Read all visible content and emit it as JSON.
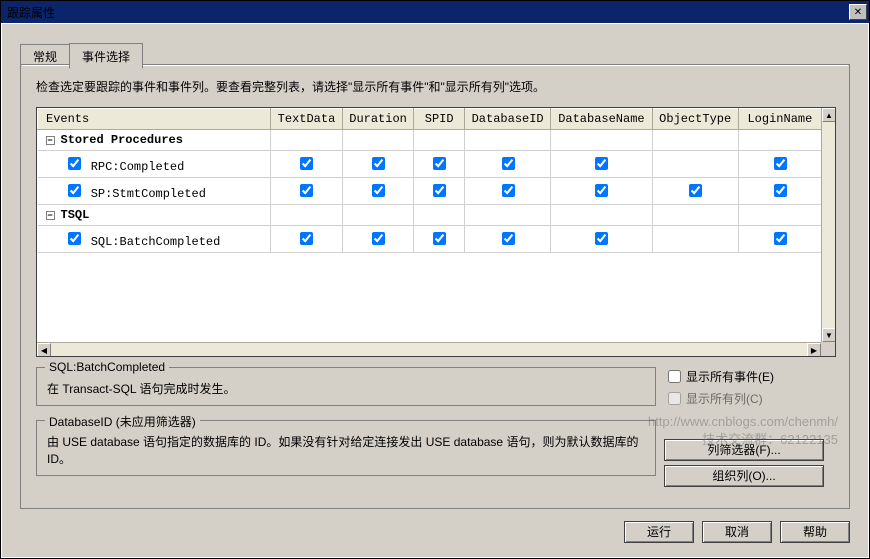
{
  "window": {
    "title": "跟踪属性"
  },
  "tabs": {
    "general": "常规",
    "events": "事件选择"
  },
  "instruction": "检查选定要跟踪的事件和事件列。要查看完整列表，请选择\"显示所有事件\"和\"显示所有列\"选项。",
  "columns": [
    "Events",
    "TextData",
    "Duration",
    "SPID",
    "DatabaseID",
    "DatabaseName",
    "ObjectType",
    "LoginName"
  ],
  "groups": [
    {
      "label": "Stored Procedures",
      "expanded": true,
      "events": [
        {
          "name": "RPC:Completed",
          "checked": true,
          "cols": {
            "TextData": true,
            "Duration": true,
            "SPID": true,
            "DatabaseID": true,
            "DatabaseName": true,
            "ObjectType": false,
            "LoginName": true
          }
        },
        {
          "name": "SP:StmtCompleted",
          "checked": true,
          "cols": {
            "TextData": true,
            "Duration": true,
            "SPID": true,
            "DatabaseID": true,
            "DatabaseName": true,
            "ObjectType": true,
            "LoginName": true
          }
        }
      ]
    },
    {
      "label": "TSQL",
      "expanded": true,
      "events": [
        {
          "name": "SQL:BatchCompleted",
          "checked": true,
          "cols": {
            "TextData": true,
            "Duration": true,
            "SPID": true,
            "DatabaseID": true,
            "DatabaseName": true,
            "ObjectType": false,
            "LoginName": true
          }
        }
      ]
    }
  ],
  "desc1": {
    "title": "SQL:BatchCompleted",
    "text": "在 Transact-SQL 语句完成时发生。"
  },
  "desc2": {
    "title": "DatabaseID (未应用筛选器)",
    "text": "由 USE database 语句指定的数据库的 ID。如果没有针对给定连接发出 USE database 语句，则为默认数据库的 ID。"
  },
  "options": {
    "show_events": "显示所有事件(E)",
    "show_cols": "显示所有列(C)",
    "col_filter": "列筛选器(F)...",
    "org_cols": "组织列(O)..."
  },
  "buttons": {
    "run": "运行",
    "cancel": "取消",
    "help": "帮助"
  },
  "watermark": {
    "line1": "http://www.cnblogs.com/chenmh/",
    "line2": "技术交流群：62122135"
  }
}
